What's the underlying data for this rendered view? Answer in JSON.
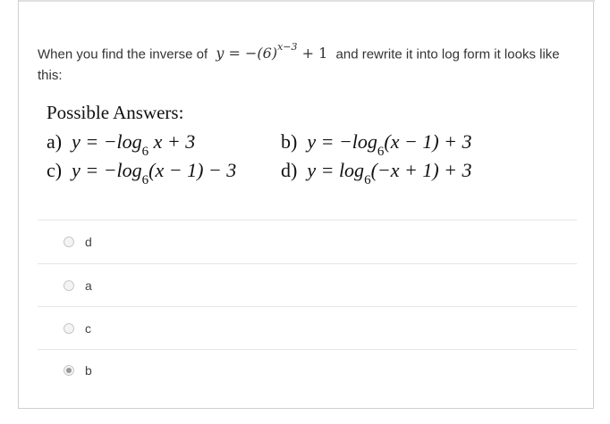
{
  "question": {
    "prefix": "When you find the inverse of",
    "equation_main": "y = −(6)",
    "equation_exponent": "x−3",
    "equation_suffix": " + 1",
    "suffix": "and rewrite it into log form it looks like this:"
  },
  "possible_answers": {
    "title": "Possible Answers:",
    "items": [
      {
        "letter": "a)",
        "text": "y = −log",
        "sub": "6",
        "after": " x + 3"
      },
      {
        "letter": "b)",
        "text": "y = −log",
        "sub": "6",
        "after": "(x − 1) + 3"
      },
      {
        "letter": "c)",
        "text": "y = −log",
        "sub": "6",
        "after": "(x − 1) − 3"
      },
      {
        "letter": "d)",
        "text": "y = log",
        "sub": "6",
        "after": "(−x + 1) + 3"
      }
    ]
  },
  "choices": [
    {
      "label": "d",
      "selected": false
    },
    {
      "label": "a",
      "selected": false
    },
    {
      "label": "c",
      "selected": false
    },
    {
      "label": "b",
      "selected": true
    }
  ]
}
